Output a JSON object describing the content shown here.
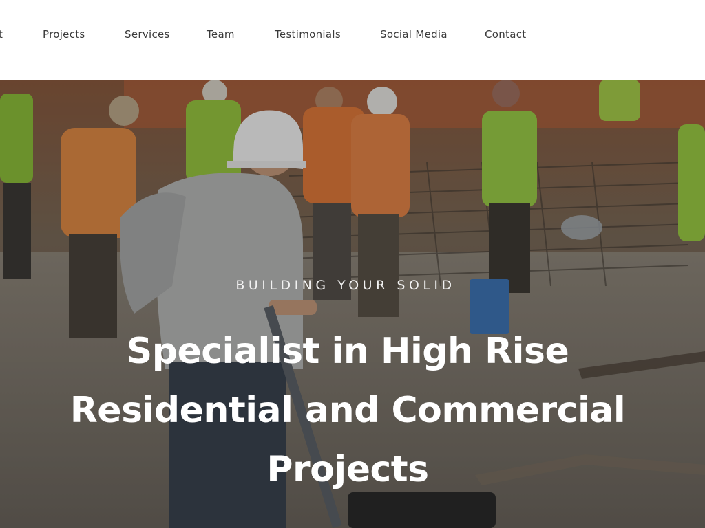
{
  "nav": {
    "items": [
      {
        "label": "t"
      },
      {
        "label": "Projects"
      },
      {
        "label": "Services"
      },
      {
        "label": "Team"
      },
      {
        "label": "Testimonials"
      },
      {
        "label": "Social Media"
      },
      {
        "label": "Contact"
      }
    ]
  },
  "hero": {
    "eyebrow": "BUILDING YOUR SOLID",
    "title_lines": [
      "Specialist in High Rise",
      "Residential and Commercial",
      "Projects"
    ]
  },
  "colors": {
    "nav_text": "#3a3a3a",
    "nav_bg": "#ffffff",
    "hero_text": "#ffffff",
    "vest_green": "#9ccc3a",
    "shirt_orange": "#e8863a"
  }
}
